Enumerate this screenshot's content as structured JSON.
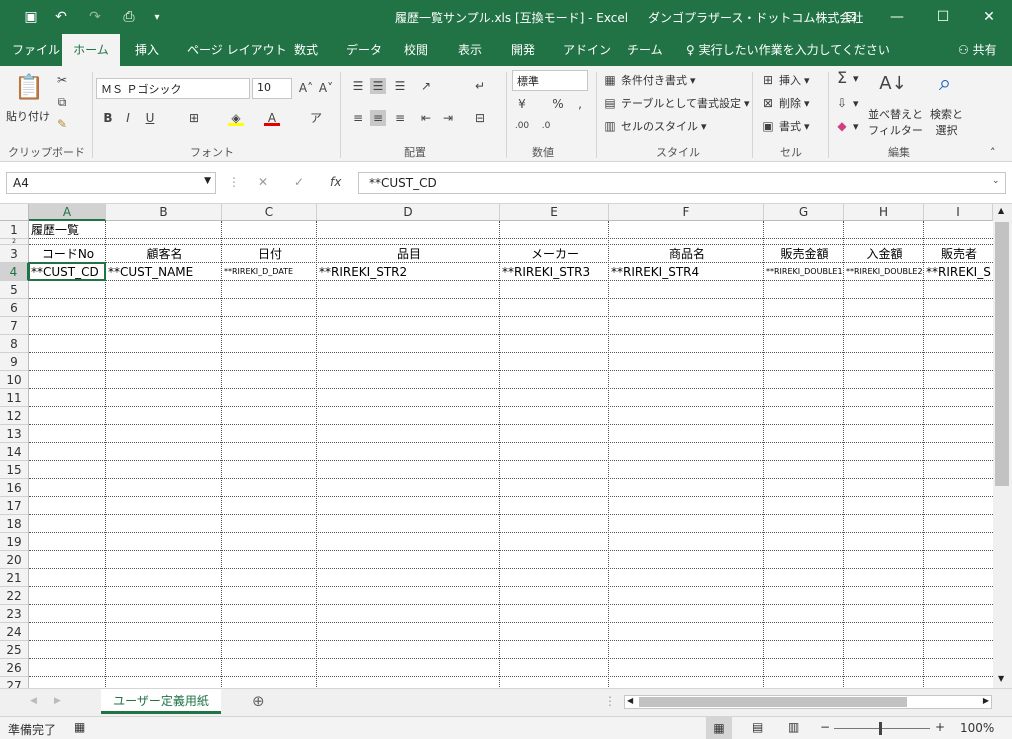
{
  "window": {
    "title": "履歴一覧サンプル.xls  [互換モード] - Excel",
    "company": "ダンゴプラザース・ドットコム株式会社"
  },
  "tabs": [
    "ファイル",
    "ホーム",
    "挿入",
    "ページ レイアウト",
    "数式",
    "データ",
    "校閲",
    "表示",
    "開発",
    "アドイン",
    "チーム"
  ],
  "tell_me": "実行したい作業を入力してください",
  "share": "共有",
  "ribbon": {
    "clipboard": {
      "paste": "貼り付け",
      "label": "クリップボード"
    },
    "font": {
      "name": "ＭＳ Ｐゴシック",
      "size": "10",
      "label": "フォント"
    },
    "alignment": {
      "label": "配置"
    },
    "number": {
      "format": "標準",
      "label": "数値"
    },
    "styles": {
      "conditional": "条件付き書式",
      "table": "テーブルとして書式設定",
      "cell": "セルのスタイル",
      "label": "スタイル"
    },
    "cells": {
      "insert": "挿入",
      "delete": "削除",
      "format": "書式",
      "label": "セル"
    },
    "editing": {
      "sort1": "並べ替えと",
      "sort2": "フィルター",
      "find1": "検索と",
      "find2": "選択",
      "label": "編集"
    }
  },
  "formula_bar": {
    "name_box": "A4",
    "fx": "fx",
    "value": "**CUST_CD"
  },
  "columns": [
    "A",
    "B",
    "C",
    "D",
    "E",
    "F",
    "G",
    "H",
    "I"
  ],
  "rows": [
    "1",
    "2",
    "3",
    "4",
    "5",
    "6",
    "7",
    "8",
    "9",
    "10",
    "11",
    "12",
    "13",
    "14",
    "15",
    "16",
    "17",
    "18",
    "19",
    "20",
    "21",
    "22",
    "23",
    "24",
    "25",
    "26",
    "27"
  ],
  "cells": {
    "a1": "履歴一覧",
    "header": [
      "コードNo",
      "顧客名",
      "日付",
      "品目",
      "メーカー",
      "商品名",
      "販売金額",
      "入金額",
      "販売者"
    ],
    "row4": [
      "**CUST_CD",
      "**CUST_NAME",
      "**RIREKI_D_DATE",
      "**RIREKI_STR2",
      "**RIREKI_STR3",
      "**RIREKI_STR4",
      "**RIREKI_DOUBLE1",
      "**RIREKI_DOUBLE2",
      "**RIREKI_S"
    ]
  },
  "sheet": {
    "name": "ユーザー定義用紙"
  },
  "status": {
    "ready": "準備完了",
    "zoom": "100%"
  }
}
